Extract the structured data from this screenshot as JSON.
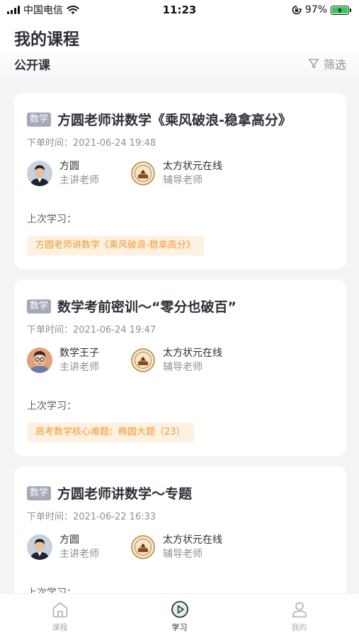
{
  "status_bar": {
    "carrier": "中国电信",
    "time": "11:23",
    "battery": "97%"
  },
  "header": {
    "title": "我的课程",
    "section": "公开课",
    "filter_label": "筛选"
  },
  "courses": [
    {
      "tag": "数学",
      "title": "方圆老师讲数学《乘风破浪-稳拿高分》",
      "order_time": "下单时间：2021-06-24 19:48",
      "teachers": [
        {
          "name": "方圆",
          "role": "主讲老师",
          "avatar": "man-avatar"
        },
        {
          "name": "太方状元在线",
          "role": "辅导老师",
          "avatar": "badge-avatar"
        }
      ],
      "last_label": "上次学习：",
      "last_lesson": "方圆老师讲数学《乘风破浪-稳拿高分》"
    },
    {
      "tag": "数学",
      "title": "数学考前密训～“零分也破百”",
      "order_time": "下单时间：2021-06-24 19:47",
      "teachers": [
        {
          "name": "数学王子",
          "role": "主讲老师",
          "avatar": "cartoon-avatar"
        },
        {
          "name": "太方状元在线",
          "role": "辅导老师",
          "avatar": "badge-avatar"
        }
      ],
      "last_label": "上次学习：",
      "last_lesson": "高考数学核心难题：椭圆大题（23）"
    },
    {
      "tag": "数学",
      "title": "方圆老师讲数学～专题",
      "order_time": "下单时间：2021-06-22 16:33",
      "teachers": [
        {
          "name": "方圆",
          "role": "主讲老师",
          "avatar": "man-avatar"
        },
        {
          "name": "太方状元在线",
          "role": "辅导老师",
          "avatar": "badge-avatar"
        }
      ],
      "last_label": "上次学习："
    }
  ],
  "tabs": [
    {
      "label": "课程",
      "icon": "house-icon",
      "active": false
    },
    {
      "label": "学习",
      "icon": "play-circle-icon",
      "active": true
    },
    {
      "label": "我的",
      "icon": "person-icon",
      "active": false
    }
  ],
  "colors": {
    "accent_orange": "#f09a33",
    "chip_bg": "#fdf1e2",
    "tag_bg": "#a3a9b8",
    "battery_green": "#34c759"
  }
}
